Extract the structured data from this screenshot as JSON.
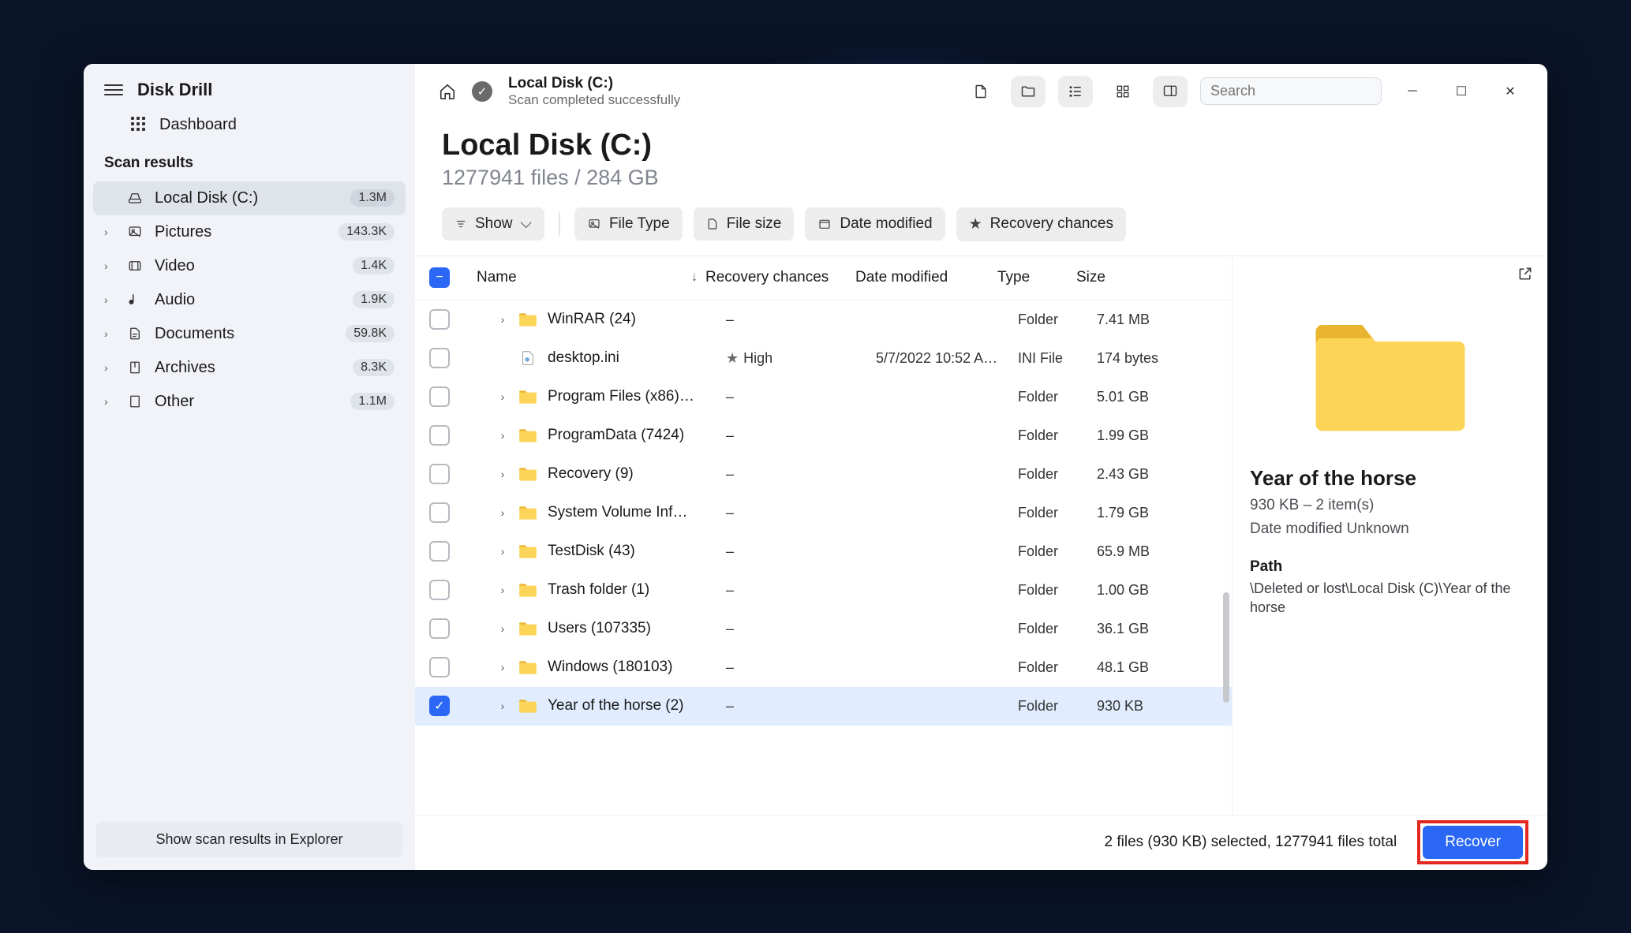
{
  "app_name": "Disk Drill",
  "dashboard_label": "Dashboard",
  "scan_results_header": "Scan results",
  "sidebar": {
    "items": [
      {
        "label": "Local Disk (C:)",
        "count": "1.3M",
        "selected": true,
        "haschev": false,
        "icon": "disk"
      },
      {
        "label": "Pictures",
        "count": "143.3K",
        "haschev": true,
        "icon": "image"
      },
      {
        "label": "Video",
        "count": "1.4K",
        "haschev": true,
        "icon": "video"
      },
      {
        "label": "Audio",
        "count": "1.9K",
        "haschev": true,
        "icon": "audio"
      },
      {
        "label": "Documents",
        "count": "59.8K",
        "haschev": true,
        "icon": "doc"
      },
      {
        "label": "Archives",
        "count": "8.3K",
        "haschev": true,
        "icon": "archive"
      },
      {
        "label": "Other",
        "count": "1.1M",
        "haschev": true,
        "icon": "other"
      }
    ]
  },
  "show_in_explorer": "Show scan results in Explorer",
  "toolbar": {
    "title": "Local Disk (C:)",
    "sub": "Scan completed successfully"
  },
  "search": {
    "placeholder": "Search"
  },
  "heading": {
    "title": "Local Disk (C:)",
    "sub": "1277941 files / 284 GB"
  },
  "filters": {
    "show": "Show",
    "file_type": "File Type",
    "file_size": "File size",
    "date": "Date modified",
    "recovery": "Recovery chances"
  },
  "columns": {
    "name": "Name",
    "recovery": "Recovery chances",
    "date": "Date modified",
    "type": "Type",
    "size": "Size"
  },
  "rows": [
    {
      "name": "WinRAR (24)",
      "rec": "–",
      "date": "",
      "type": "Folder",
      "size": "7.41 MB",
      "expand": true,
      "icon": "folder"
    },
    {
      "name": "desktop.ini",
      "rec": "High",
      "rec_star": true,
      "date": "5/7/2022 10:52 A…",
      "type": "INI File",
      "size": "174 bytes",
      "expand": false,
      "icon": "file"
    },
    {
      "name": "Program Files (x86)…",
      "rec": "–",
      "date": "",
      "type": "Folder",
      "size": "5.01 GB",
      "expand": true,
      "icon": "folder"
    },
    {
      "name": "ProgramData (7424)",
      "rec": "–",
      "date": "",
      "type": "Folder",
      "size": "1.99 GB",
      "expand": true,
      "icon": "folder"
    },
    {
      "name": "Recovery (9)",
      "rec": "–",
      "date": "",
      "type": "Folder",
      "size": "2.43 GB",
      "expand": true,
      "icon": "folder"
    },
    {
      "name": "System Volume Inf…",
      "rec": "–",
      "date": "",
      "type": "Folder",
      "size": "1.79 GB",
      "expand": true,
      "icon": "folder"
    },
    {
      "name": "TestDisk (43)",
      "rec": "–",
      "date": "",
      "type": "Folder",
      "size": "65.9 MB",
      "expand": true,
      "icon": "folder"
    },
    {
      "name": "Trash folder (1)",
      "rec": "–",
      "date": "",
      "type": "Folder",
      "size": "1.00 GB",
      "expand": true,
      "icon": "folder"
    },
    {
      "name": "Users (107335)",
      "rec": "–",
      "date": "",
      "type": "Folder",
      "size": "36.1 GB",
      "expand": true,
      "icon": "folder"
    },
    {
      "name": "Windows (180103)",
      "rec": "–",
      "date": "",
      "type": "Folder",
      "size": "48.1 GB",
      "expand": true,
      "icon": "folder"
    },
    {
      "name": "Year of the horse (2)",
      "rec": "–",
      "date": "",
      "type": "Folder",
      "size": "930 KB",
      "expand": true,
      "icon": "folder",
      "checked": true,
      "selected": true
    }
  ],
  "details": {
    "title": "Year of the horse",
    "meta": "930 KB – 2 item(s)",
    "date_mod": "Date modified Unknown",
    "path_label": "Path",
    "path": "\\Deleted or lost\\Local Disk (C)\\Year of the horse"
  },
  "footer": {
    "status": "2 files (930 KB) selected, 1277941 files total",
    "recover": "Recover"
  }
}
